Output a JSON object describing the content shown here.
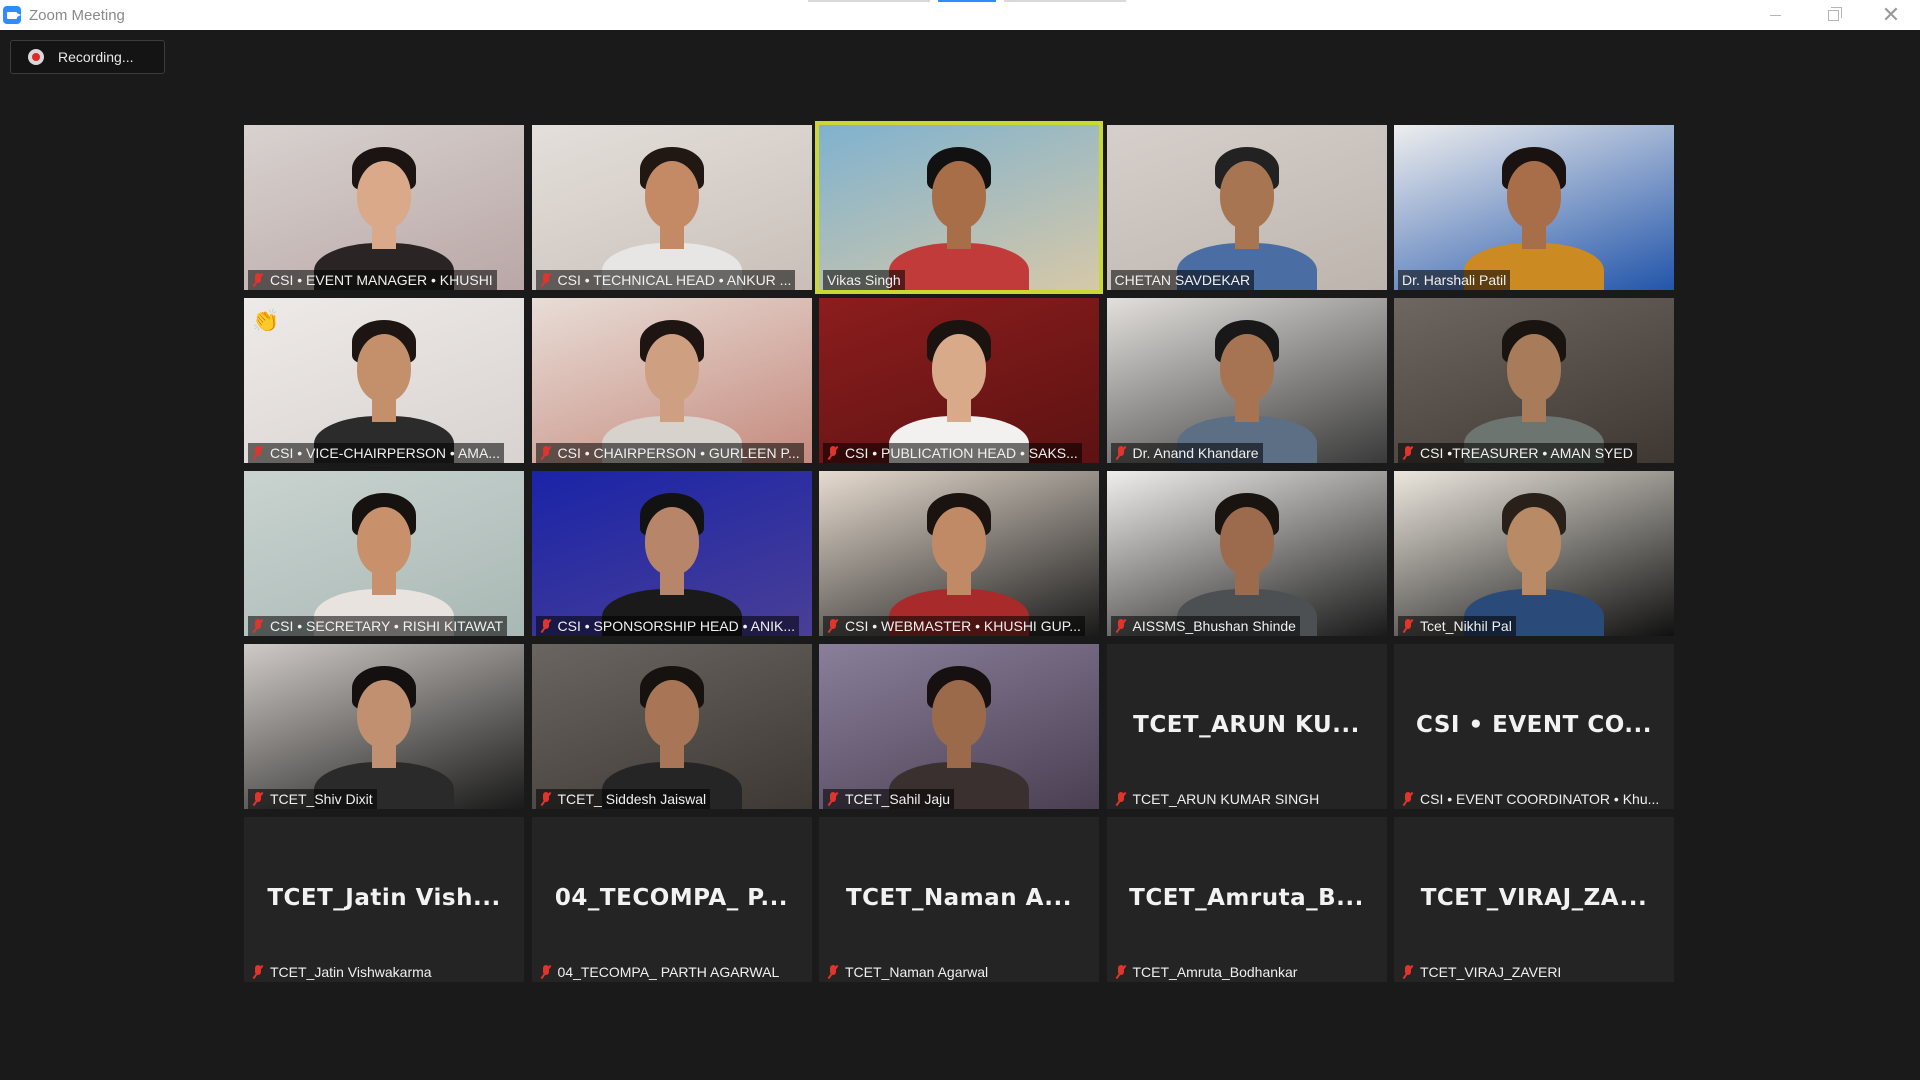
{
  "window": {
    "title": "Zoom Meeting",
    "controls": [
      "minimize",
      "restore",
      "close"
    ],
    "close_glyph": "✕"
  },
  "recording": {
    "label": "Recording..."
  },
  "colors": {
    "background": "#1a1a1a",
    "active_speaker_border": "#c9d833",
    "muted_mic": "#e0342c",
    "zoom_blue": "#2d8cff"
  },
  "participants": [
    {
      "name": "CSI • EVENT MANAGER • KHUSHI",
      "video": true,
      "muted": true,
      "bg": [
        "#d8d2cf",
        "#b9a7a6"
      ],
      "skin": "#d9a989",
      "hair": "#1c1412",
      "shirt": "#2a2424"
    },
    {
      "name": "CSI • TECHNICAL HEAD • ANKUR ...",
      "video": true,
      "muted": true,
      "bg": [
        "#e4dfdb",
        "#c9bfb8"
      ],
      "skin": "#c48a66",
      "hair": "#211814",
      "shirt": "#e8e6e4"
    },
    {
      "name": "Vikas Singh",
      "video": true,
      "muted": false,
      "active": true,
      "bg": [
        "#7fb2cf",
        "#d6c8a8"
      ],
      "skin": "#a86e48",
      "hair": "#111",
      "shirt": "#c23b3b"
    },
    {
      "name": "CHETAN SAVDEKAR",
      "video": true,
      "muted": false,
      "bg": [
        "#d6cfcb",
        "#bdb4ad"
      ],
      "skin": "#a87552",
      "hair": "#222",
      "shirt": "#4a6ea3"
    },
    {
      "name": "Dr. Harshali Patil",
      "video": true,
      "muted": false,
      "bg": [
        "#eeeeee",
        "#2255aa"
      ],
      "skin": "#a86e4a",
      "hair": "#1a1210",
      "shirt": "#cc8a22"
    },
    {
      "name": "CSI • VICE-CHAIRPERSON • AMA...",
      "video": true,
      "muted": true,
      "wave": "👏",
      "bg": [
        "#eeeae8",
        "#d8d3d0"
      ],
      "skin": "#c4906c",
      "hair": "#1d1512",
      "shirt": "#2b2b2b"
    },
    {
      "name": "CSI • CHAIRPERSON • GURLEEN P...",
      "video": true,
      "muted": true,
      "bg": [
        "#e8ddd6",
        "#c58a7e"
      ],
      "skin": "#cf9f82",
      "hair": "#1e1512",
      "shirt": "#d8d2cc"
    },
    {
      "name": "CSI • PUBLICATION HEAD • SAKS...",
      "video": true,
      "muted": true,
      "bg": [
        "#8c1d1d",
        "#5d1212"
      ],
      "skin": "#d8aa8a",
      "hair": "#1a1310",
      "shirt": "#f3f1ef"
    },
    {
      "name": "Dr. Anand Khandare",
      "video": true,
      "muted": true,
      "bg": [
        "#e2dfdc",
        "#3a3a3a"
      ],
      "skin": "#a67453",
      "hair": "#181818",
      "shirt": "#5c6f85"
    },
    {
      "name": "CSI •TREASURER • AMAN SYED",
      "video": true,
      "muted": true,
      "bg": [
        "#6e6660",
        "#3e3732"
      ],
      "skin": "#a87b5a",
      "hair": "#1a1410",
      "shirt": "#6d7570"
    },
    {
      "name": "CSI • SECRETARY • RISHI KITAWAT",
      "video": true,
      "muted": true,
      "bg": [
        "#c9d3d0",
        "#a9b8b4"
      ],
      "skin": "#c8916c",
      "hair": "#161210",
      "shirt": "#e9e3e0"
    },
    {
      "name": "CSI • SPONSORSHIP HEAD • ANIK...",
      "video": true,
      "muted": true,
      "bg": [
        "#1a24a8",
        "#4a3f96"
      ],
      "skin": "#b7856a",
      "hair": "#121212",
      "shirt": "#1a1a1a"
    },
    {
      "name": "CSI • WEBMASTER • KHUSHI GUP...",
      "video": true,
      "muted": true,
      "bg": [
        "#e6dbcf",
        "#1a1a1a"
      ],
      "skin": "#c08a66",
      "hair": "#1a1310",
      "shirt": "#a82a2a"
    },
    {
      "name": "AISSMS_Bhushan Shinde",
      "video": true,
      "muted": true,
      "bg": [
        "#f0eeec",
        "#1a1a1a"
      ],
      "skin": "#9c6b4d",
      "hair": "#1a1410",
      "shirt": "#4c5052"
    },
    {
      "name": "Tcet_Nikhil Pal",
      "video": true,
      "muted": true,
      "bg": [
        "#ece7de",
        "#111111"
      ],
      "skin": "#b88a66",
      "hair": "#2a201a",
      "shirt": "#2a4a7a"
    },
    {
      "name": "TCET_Shiv Dixit",
      "video": true,
      "muted": true,
      "bg": [
        "#cfcac6",
        "#1a1a1a"
      ],
      "skin": "#c09070",
      "hair": "#141010",
      "shirt": "#2a2a2a"
    },
    {
      "name": "TCET_ Siddesh Jaiswal",
      "video": true,
      "muted": true,
      "bg": [
        "#6a6560",
        "#3d3833"
      ],
      "skin": "#a87656",
      "hair": "#161210",
      "shirt": "#252525"
    },
    {
      "name": "TCET_Sahil Jaju",
      "video": true,
      "muted": true,
      "bg": [
        "#8a7f9a",
        "#4a3f52"
      ],
      "skin": "#9a6a4a",
      "hair": "#161010",
      "shirt": "#3a3030"
    },
    {
      "name": "TCET_ARUN KUMAR SINGH",
      "display": "TCET_ARUN  KU...",
      "video": false,
      "muted": true
    },
    {
      "name": "CSI • EVENT COORDINATOR • Khu...",
      "display": "CSI • EVENT CO...",
      "video": false,
      "muted": true
    },
    {
      "name": "TCET_Jatin Vishwakarma",
      "display": "TCET_Jatin  Vish...",
      "video": false,
      "muted": true
    },
    {
      "name": "04_TECOMPA_ PARTH AGARWAL",
      "display": "04_TECOMPA_ P...",
      "video": false,
      "muted": true
    },
    {
      "name": "TCET_Naman Agarwal",
      "display": "TCET_Naman  A...",
      "video": false,
      "muted": true
    },
    {
      "name": "TCET_Amruta_Bodhankar",
      "display": "TCET_Amruta_B...",
      "video": false,
      "muted": true
    },
    {
      "name": "TCET_VIRAJ_ZAVERI",
      "display": "TCET_VIRAJ_ZA...",
      "video": false,
      "muted": true
    }
  ]
}
